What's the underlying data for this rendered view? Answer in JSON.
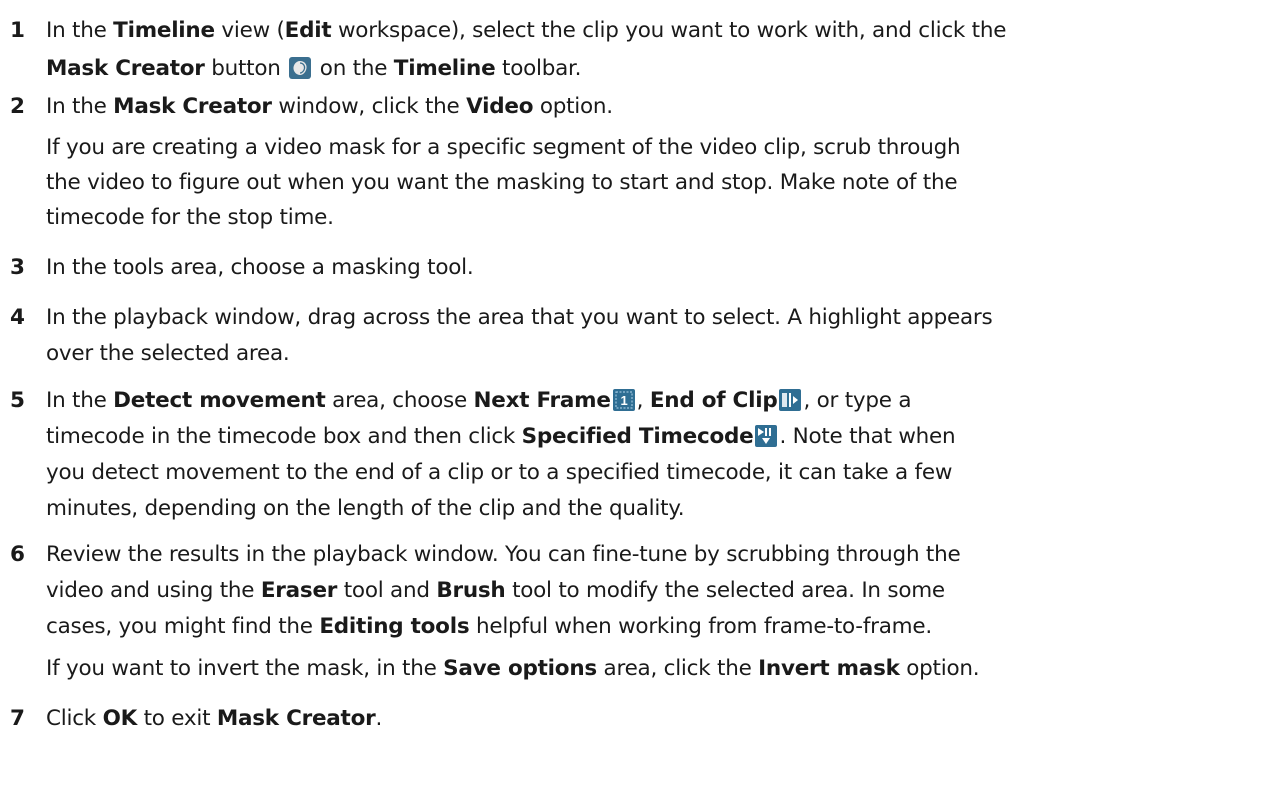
{
  "steps": [
    {
      "num": "1",
      "lines": [
        [
          "In the ",
          "Timeline",
          " view (",
          "Edit",
          " workspace), select the clip you want to work with, and click the"
        ],
        [
          "Mask Creator",
          " button ",
          " on the ",
          "Timeline",
          " toolbar."
        ]
      ]
    },
    {
      "num": "2",
      "lines": [
        [
          "In the ",
          "Mask Creator",
          " window, click the ",
          "Video",
          " option."
        ]
      ],
      "note": [
        "If you are creating a video mask for a specific segment of the video clip, scrub through",
        "the video to figure out when you want the masking to start and stop. Make note of the",
        "timecode for the stop time."
      ]
    },
    {
      "num": "3",
      "lines": [
        [
          "In the tools area, choose a masking tool."
        ]
      ]
    },
    {
      "num": "4",
      "lines": [
        [
          "In the playback window, drag across the area that you want to select. A highlight appears"
        ],
        [
          "over the selected area."
        ]
      ]
    },
    {
      "num": "5",
      "lines": [
        [
          "In the ",
          "Detect movement",
          " area, choose ",
          "Next Frame",
          ", ",
          "End of Clip",
          ", or type a"
        ],
        [
          "timecode in the timecode box and then click ",
          "Specified Timecode",
          ". Note that when"
        ],
        [
          "you detect movement to the end of a clip or to a specified timecode, it can take a few"
        ],
        [
          "minutes, depending on the length of the clip and the quality."
        ]
      ]
    },
    {
      "num": "6",
      "lines": [
        [
          "Review the results in the playback window. You can fine-tune by scrubbing through the"
        ],
        [
          "video and using the ",
          "Eraser",
          " tool and ",
          "Brush",
          " tool to modify the selected area. In some"
        ],
        [
          "cases, you might find the ",
          "Editing tools",
          " helpful when working from frame-to-frame."
        ]
      ],
      "note": [
        "If you want to invert the mask, in the ",
        "Save options",
        " area, click the ",
        "Invert mask",
        " option."
      ]
    },
    {
      "num": "7",
      "lines": [
        [
          "Click ",
          "OK",
          " to exit ",
          "Mask Creator",
          "."
        ]
      ]
    }
  ],
  "icons": {
    "mask_creator": "mask-creator-icon",
    "next_frame": "next-frame-icon",
    "end_of_clip": "end-of-clip-icon",
    "specified_timecode": "specified-timecode-icon"
  },
  "colors": {
    "text": "#1a1a1a",
    "icon_bg": "#2f6e93",
    "icon_fg": "#ffffff"
  }
}
